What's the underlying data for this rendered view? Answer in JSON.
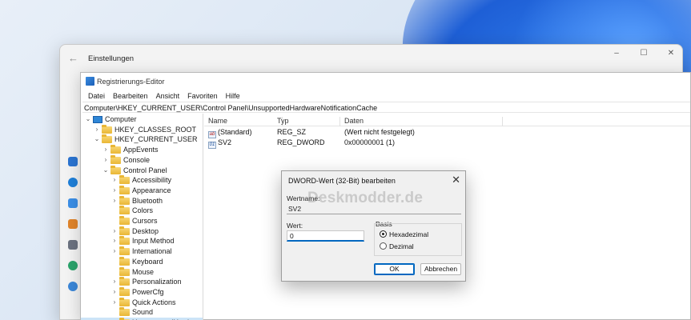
{
  "settings": {
    "title": "Einstellungen",
    "back_glyph": "←",
    "controls": [
      "–",
      "☐",
      "✕"
    ]
  },
  "regedit": {
    "title": "Registrierungs-Editor",
    "menu": [
      "Datei",
      "Bearbeiten",
      "Ansicht",
      "Favoriten",
      "Hilfe"
    ],
    "address": "Computer\\HKEY_CURRENT_USER\\Control Panel\\UnsupportedHardwareNotificationCache",
    "tree": [
      {
        "label": "Computer",
        "level": 0,
        "expander": "⌄",
        "icon": "pc"
      },
      {
        "label": "HKEY_CLASSES_ROOT",
        "level": 1,
        "expander": "›",
        "icon": "folder"
      },
      {
        "label": "HKEY_CURRENT_USER",
        "level": 1,
        "expander": "⌄",
        "icon": "folder"
      },
      {
        "label": "AppEvents",
        "level": 2,
        "expander": "›",
        "icon": "folder"
      },
      {
        "label": "Console",
        "level": 2,
        "expander": "›",
        "icon": "folder"
      },
      {
        "label": "Control Panel",
        "level": 2,
        "expander": "⌄",
        "icon": "folder"
      },
      {
        "label": "Accessibility",
        "level": 3,
        "expander": "›",
        "icon": "folder"
      },
      {
        "label": "Appearance",
        "level": 3,
        "expander": "›",
        "icon": "folder"
      },
      {
        "label": "Bluetooth",
        "level": 3,
        "expander": "›",
        "icon": "folder"
      },
      {
        "label": "Colors",
        "level": 3,
        "expander": "",
        "icon": "folder"
      },
      {
        "label": "Cursors",
        "level": 3,
        "expander": "",
        "icon": "folder"
      },
      {
        "label": "Desktop",
        "level": 3,
        "expander": "›",
        "icon": "folder"
      },
      {
        "label": "Input Method",
        "level": 3,
        "expander": "›",
        "icon": "folder"
      },
      {
        "label": "International",
        "level": 3,
        "expander": "›",
        "icon": "folder"
      },
      {
        "label": "Keyboard",
        "level": 3,
        "expander": "",
        "icon": "folder"
      },
      {
        "label": "Mouse",
        "level": 3,
        "expander": "",
        "icon": "folder"
      },
      {
        "label": "Personalization",
        "level": 3,
        "expander": "›",
        "icon": "folder"
      },
      {
        "label": "PowerCfg",
        "level": 3,
        "expander": "›",
        "icon": "folder"
      },
      {
        "label": "Quick Actions",
        "level": 3,
        "expander": "›",
        "icon": "folder"
      },
      {
        "label": "Sound",
        "level": 3,
        "expander": "",
        "icon": "folder"
      },
      {
        "label": "UnsupportedHardwareNotificationCache",
        "level": 3,
        "expander": "",
        "icon": "folder",
        "selected": true
      }
    ],
    "columns": [
      "Name",
      "Typ",
      "Daten"
    ],
    "rows": [
      {
        "name": "(Standard)",
        "type": "REG_SZ",
        "data": "(Wert nicht festgelegt)",
        "icon": "ab"
      },
      {
        "name": "SV2",
        "type": "REG_DWORD",
        "data": "0x00000001 (1)",
        "icon": "01"
      }
    ]
  },
  "dialog": {
    "title": "DWORD-Wert (32-Bit) bearbeiten",
    "close_glyph": "✕",
    "name_label": "Wertname:",
    "name_value": "SV2",
    "value_label": "Wert:",
    "value": "0",
    "basis_label": "Basis",
    "radio_hex": "Hexadezimal",
    "radio_dec": "Dezimal",
    "ok_label": "OK",
    "cancel_label": "Abbrechen",
    "watermark": "Deskmodder.de"
  },
  "colors": {
    "accent": "#0067c0",
    "selection": "#cce4f7",
    "folder": "#e9b634"
  }
}
